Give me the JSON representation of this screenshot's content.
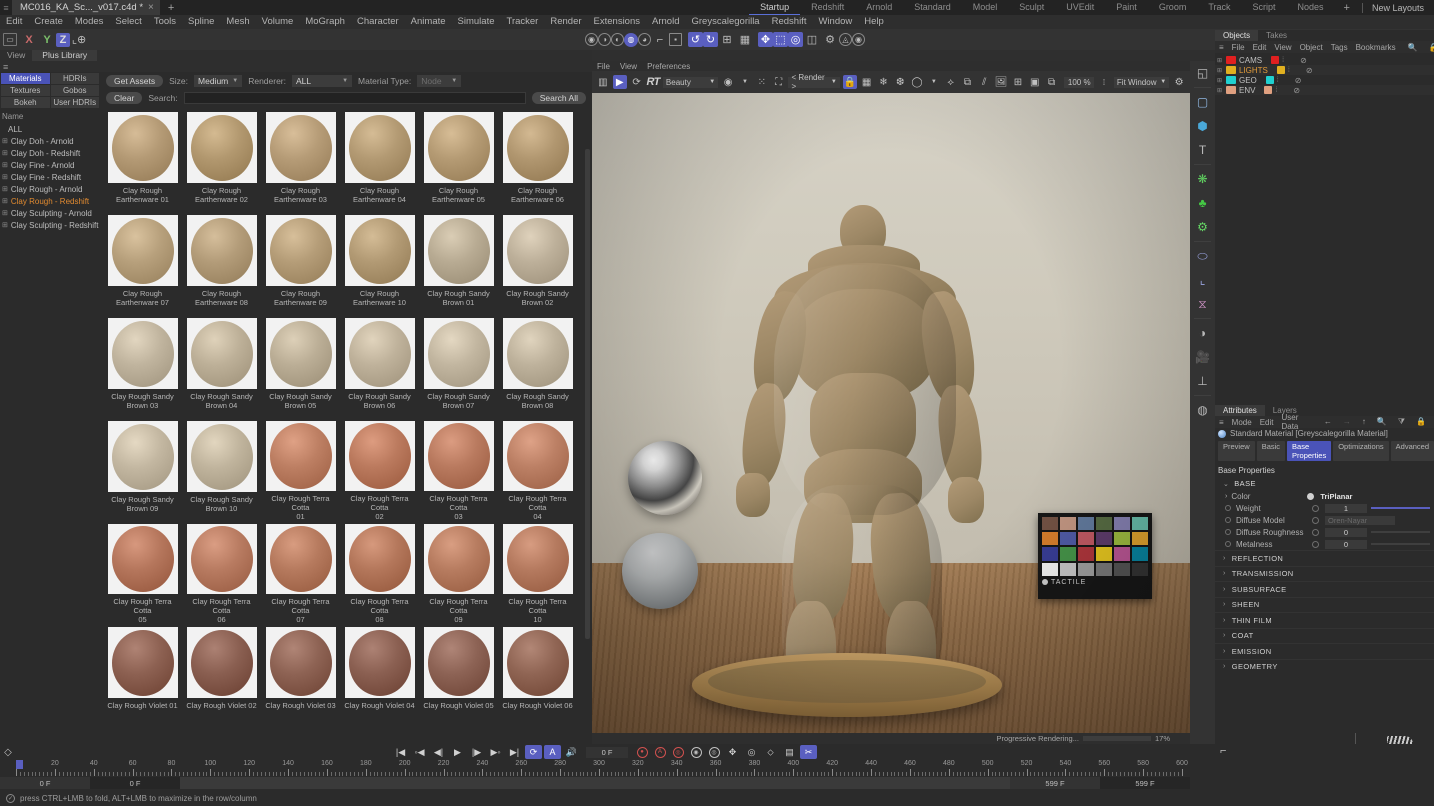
{
  "titlebar": {
    "document_tab": "MC016_KA_Sc..._v017.c4d *",
    "close_label": "×",
    "new_tab_label": "+",
    "layout_tabs": [
      {
        "label": "Startup",
        "active": true
      },
      {
        "label": "Redshift",
        "active": false
      },
      {
        "label": "Arnold",
        "active": false
      },
      {
        "label": "Standard",
        "active": false
      },
      {
        "label": "Model",
        "active": false
      },
      {
        "label": "Sculpt",
        "active": false
      },
      {
        "label": "UVEdit",
        "active": false
      },
      {
        "label": "Paint",
        "active": false
      },
      {
        "label": "Groom",
        "active": false
      },
      {
        "label": "Track",
        "active": false
      },
      {
        "label": "Script",
        "active": false
      },
      {
        "label": "Nodes",
        "active": false
      }
    ],
    "layout_add": "+",
    "layout_name": "New Layouts"
  },
  "menubar": {
    "items": [
      "Edit",
      "Create",
      "Modes",
      "Select",
      "Tools",
      "Spline",
      "Mesh",
      "Volume",
      "MoGraph",
      "Character",
      "Animate",
      "Simulate",
      "Tracker",
      "Render",
      "Extensions",
      "Arnold",
      "Greyscalegorilla",
      "Redshift",
      "Window",
      "Help"
    ]
  },
  "toolbar": {
    "axis_x": "X",
    "axis_y": "Y",
    "axis_z": "Z"
  },
  "viewbar": {
    "view_label": "View",
    "library_label": "Plus Library"
  },
  "library": {
    "category_tabs": [
      {
        "label": "Materials",
        "active": true
      },
      {
        "label": "HDRIs",
        "active": false
      },
      {
        "label": "Textures",
        "active": false
      },
      {
        "label": "Gobos",
        "active": false
      },
      {
        "label": "Bokeh",
        "active": false
      },
      {
        "label": "User HDRIs",
        "active": false
      }
    ],
    "tree_header": "Name",
    "tree_items": [
      {
        "label": "ALL",
        "selected": false,
        "root": true
      },
      {
        "label": "Clay Doh - Arnold",
        "selected": false
      },
      {
        "label": "Clay Doh - Redshift",
        "selected": false
      },
      {
        "label": "Clay Fine - Arnold",
        "selected": false
      },
      {
        "label": "Clay Fine - Redshift",
        "selected": false
      },
      {
        "label": "Clay Rough - Arnold",
        "selected": false
      },
      {
        "label": "Clay Rough - Redshift",
        "selected": true
      },
      {
        "label": "Clay Sculpting - Arnold",
        "selected": false
      },
      {
        "label": "Clay Sculpting - Redshift",
        "selected": false
      }
    ],
    "toolbar": {
      "get_assets": "Get Assets",
      "size_label": "Size:",
      "size_value": "Medium",
      "renderer_label": "Renderer:",
      "renderer_value": "ALL",
      "material_type_label": "Material Type:",
      "material_type_value": "Node",
      "clear": "Clear",
      "search_label": "Search:",
      "search_value": "",
      "search_all": "Search All"
    },
    "assets": [
      {
        "name1": "Clay Rough",
        "name2": "Earthenware 01",
        "color": "#b49a75"
      },
      {
        "name1": "Clay Rough",
        "name2": "Earthenware 02",
        "color": "#b2986f"
      },
      {
        "name1": "Clay Rough",
        "name2": "Earthenware 03",
        "color": "#b69c77"
      },
      {
        "name1": "Clay Rough",
        "name2": "Earthenware 04",
        "color": "#b39a73"
      },
      {
        "name1": "Clay Rough",
        "name2": "Earthenware 05",
        "color": "#b59b74"
      },
      {
        "name1": "Clay Rough",
        "name2": "Earthenware 06",
        "color": "#b19770"
      },
      {
        "name1": "Clay Rough",
        "name2": "Earthenware 07",
        "color": "#b7a07c"
      },
      {
        "name1": "Clay Rough",
        "name2": "Earthenware 08",
        "color": "#b39c79"
      },
      {
        "name1": "Clay Rough",
        "name2": "Earthenware 09",
        "color": "#b59d78"
      },
      {
        "name1": "Clay Rough",
        "name2": "Earthenware 10",
        "color": "#b29a74"
      },
      {
        "name1": "Clay Rough Sandy",
        "name2": "Brown 01",
        "color": "#b8ab93"
      },
      {
        "name1": "Clay Rough Sandy",
        "name2": "Brown 02",
        "color": "#bdb09a"
      },
      {
        "name1": "Clay Rough Sandy",
        "name2": "Brown 03",
        "color": "#c0b49e"
      },
      {
        "name1": "Clay Rough Sandy",
        "name2": "Brown 04",
        "color": "#bdb098"
      },
      {
        "name1": "Clay Rough Sandy",
        "name2": "Brown 05",
        "color": "#bbae96"
      },
      {
        "name1": "Clay Rough Sandy",
        "name2": "Brown 06",
        "color": "#bfb29b"
      },
      {
        "name1": "Clay Rough Sandy",
        "name2": "Brown 07",
        "color": "#c2b6a0"
      },
      {
        "name1": "Clay Rough Sandy",
        "name2": "Brown 08",
        "color": "#beb29c"
      },
      {
        "name1": "Clay Rough Sandy",
        "name2": "Brown 09",
        "color": "#c3b7a1"
      },
      {
        "name1": "Clay Rough Sandy",
        "name2": "Brown 10",
        "color": "#c0b49d"
      },
      {
        "name1": "Clay Rough Terra Cotta",
        "name2": "01",
        "color": "#bd7f63"
      },
      {
        "name1": "Clay Rough Terra Cotta",
        "name2": "02",
        "color": "#bb7a5e"
      },
      {
        "name1": "Clay Rough Terra Cotta",
        "name2": "03",
        "color": "#b97a5f"
      },
      {
        "name1": "Clay Rough Terra Cotta",
        "name2": "04",
        "color": "#bc8065"
      },
      {
        "name1": "Clay Rough Terra Cotta",
        "name2": "05",
        "color": "#b5765c"
      },
      {
        "name1": "Clay Rough Terra Cotta",
        "name2": "06",
        "color": "#b87b61"
      },
      {
        "name1": "Clay Rough Terra Cotta",
        "name2": "07",
        "color": "#b67a5e"
      },
      {
        "name1": "Clay Rough Terra Cotta",
        "name2": "08",
        "color": "#b4775b"
      },
      {
        "name1": "Clay Rough Terra Cotta",
        "name2": "09",
        "color": "#b77c60"
      },
      {
        "name1": "Clay Rough Terra Cotta",
        "name2": "10",
        "color": "#b57a5f"
      },
      {
        "name1": "Clay Rough Violet 01",
        "name2": "",
        "color": "#8d6152"
      },
      {
        "name1": "Clay Rough Violet 02",
        "name2": "",
        "color": "#8a5f51"
      },
      {
        "name1": "Clay Rough Violet 03",
        "name2": "",
        "color": "#8e6354"
      },
      {
        "name1": "Clay Rough Violet 04",
        "name2": "",
        "color": "#8b6052"
      },
      {
        "name1": "Clay Rough Violet 05",
        "name2": "",
        "color": "#8d6355"
      },
      {
        "name1": "Clay Rough Violet 06",
        "name2": "",
        "color": "#906554"
      }
    ]
  },
  "viewport": {
    "menu": [
      "File",
      "View",
      "Preferences"
    ],
    "rt_label": "RT",
    "aov_value": "Beauty",
    "camera_value": "< Render >",
    "zoom_value": "100 %",
    "fit_value": "Fit Window",
    "progress_label": "Progressive Rendering...",
    "progress_value": "17%",
    "progress_percent": 17,
    "checker_label": "TACTILE"
  },
  "objects_panel": {
    "tabs": [
      {
        "label": "Objects",
        "active": true
      },
      {
        "label": "Takes",
        "active": false
      }
    ],
    "menu": [
      "File",
      "Edit",
      "View",
      "Object",
      "Tags",
      "Bookmarks"
    ],
    "rows": [
      {
        "name": "CAMS",
        "color": "#e02020",
        "highlight": false
      },
      {
        "name": "LIGHTS",
        "color": "#e0b020",
        "highlight": true
      },
      {
        "name": "GEO",
        "color": "#20d0d0",
        "highlight": false
      },
      {
        "name": "ENV",
        "color": "#e0a080",
        "highlight": false
      }
    ]
  },
  "attributes_panel": {
    "tabs": [
      {
        "label": "Attributes",
        "active": true
      },
      {
        "label": "Layers",
        "active": false
      }
    ],
    "menu": [
      "Mode",
      "Edit",
      "User Data"
    ],
    "material_title": "Standard Material [Greyscalegorilla Material]",
    "prop_tabs": [
      {
        "label": "Preview",
        "active": false
      },
      {
        "label": "Basic",
        "active": false
      },
      {
        "label": "Base Properties",
        "active": true
      },
      {
        "label": "Optimizations",
        "active": false
      },
      {
        "label": "Advanced",
        "active": false
      }
    ],
    "section_title": "Base Properties",
    "group_label": "BASE",
    "properties": [
      {
        "name": "Color",
        "value": "TriPlanar",
        "type": "link"
      },
      {
        "name": "Weight",
        "value": "1",
        "type": "slider",
        "slider": true
      },
      {
        "name": "Diffuse Model",
        "value": "Oren-Nayar",
        "type": "dropdown"
      },
      {
        "name": "Diffuse Roughness",
        "value": "0",
        "type": "slider",
        "slider": false
      },
      {
        "name": "Metalness",
        "value": "0",
        "type": "slider",
        "slider": false
      }
    ],
    "collapsed_sections": [
      "REFLECTION",
      "TRANSMISSION",
      "SUBSURFACE",
      "SHEEN",
      "THIN FILM",
      "COAT",
      "EMISSION",
      "GEOMETRY"
    ]
  },
  "branding": {
    "greyscalegorilla": "Greyscalegorilla",
    "plus": "+",
    "tactile": "TACTILE"
  },
  "timeline": {
    "frame_value": "0 F",
    "range_start": "0 F",
    "range_start2": "0 F",
    "range_end": "599 F",
    "range_end2": "599 F",
    "ticks": [
      0,
      20,
      40,
      60,
      80,
      100,
      120,
      140,
      160,
      180,
      200,
      220,
      240,
      260,
      280,
      300,
      320,
      340,
      360,
      380,
      400,
      420,
      440,
      460,
      480,
      500,
      520,
      540,
      560,
      580,
      600
    ]
  },
  "statusbar": {
    "message": "press CTRL+LMB to fold, ALT+LMB to maximize in the row/column"
  },
  "colors": {
    "accent": "#5a5fc0",
    "selected_tree": "#e08a30",
    "panel_bg": "#2b2b2b",
    "toolbar_bg": "#333333"
  }
}
